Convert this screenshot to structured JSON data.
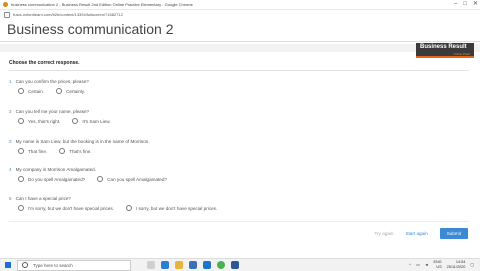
{
  "browser": {
    "window_title": "business communication 2 - Business Result 2nd Edition Online Practice Elementary - Google Chrome",
    "url": "fracs.oxfordlearn.com/b2b/content/13394/fullscreen/?1682712",
    "controls": [
      "–",
      "□",
      "✕"
    ]
  },
  "page": {
    "title": "Business communication 2",
    "instruction": "Choose the correct response.",
    "logo": {
      "line1": "Business Result",
      "line2": "Online Pract"
    }
  },
  "questions": [
    {
      "number": "1",
      "text": "Can you confirm the prices, please?",
      "options": [
        "Certain.",
        "Certainly."
      ]
    },
    {
      "number": "2",
      "text": "Can you tell me your name, please?",
      "options": [
        "Yes, that's right.",
        "It's Sam Liew."
      ]
    },
    {
      "number": "3",
      "text": "My name is Sam Liew, but the booking is in the name of Morrison.",
      "options": [
        "That fine.",
        "That's fine."
      ]
    },
    {
      "number": "4",
      "text": "My company is Morrison Amalgamated.",
      "options": [
        "Do you spell Amalgamated?",
        "Can you spell Amalgamated?"
      ]
    },
    {
      "number": "5",
      "text": "Can I have a special price?",
      "options": [
        "I'm sorry, but we don't have special prices.",
        "I sorry, but we don't have special prices."
      ]
    }
  ],
  "footer": {
    "try_again": "Try again",
    "start_again": "Start again",
    "submit": "Submit"
  },
  "taskbar": {
    "search_placeholder": "Type here to search",
    "lang": "ENG",
    "region": "US",
    "time": "14:54",
    "date": "25/11/2020",
    "icons": [
      "task-view-icon",
      "edge-icon",
      "file-explorer-icon",
      "store-icon",
      "mail-icon",
      "chrome-icon",
      "word-icon"
    ]
  },
  "colors": {
    "accent": "#3c8ad6",
    "brand_orange": "#e2671d"
  }
}
